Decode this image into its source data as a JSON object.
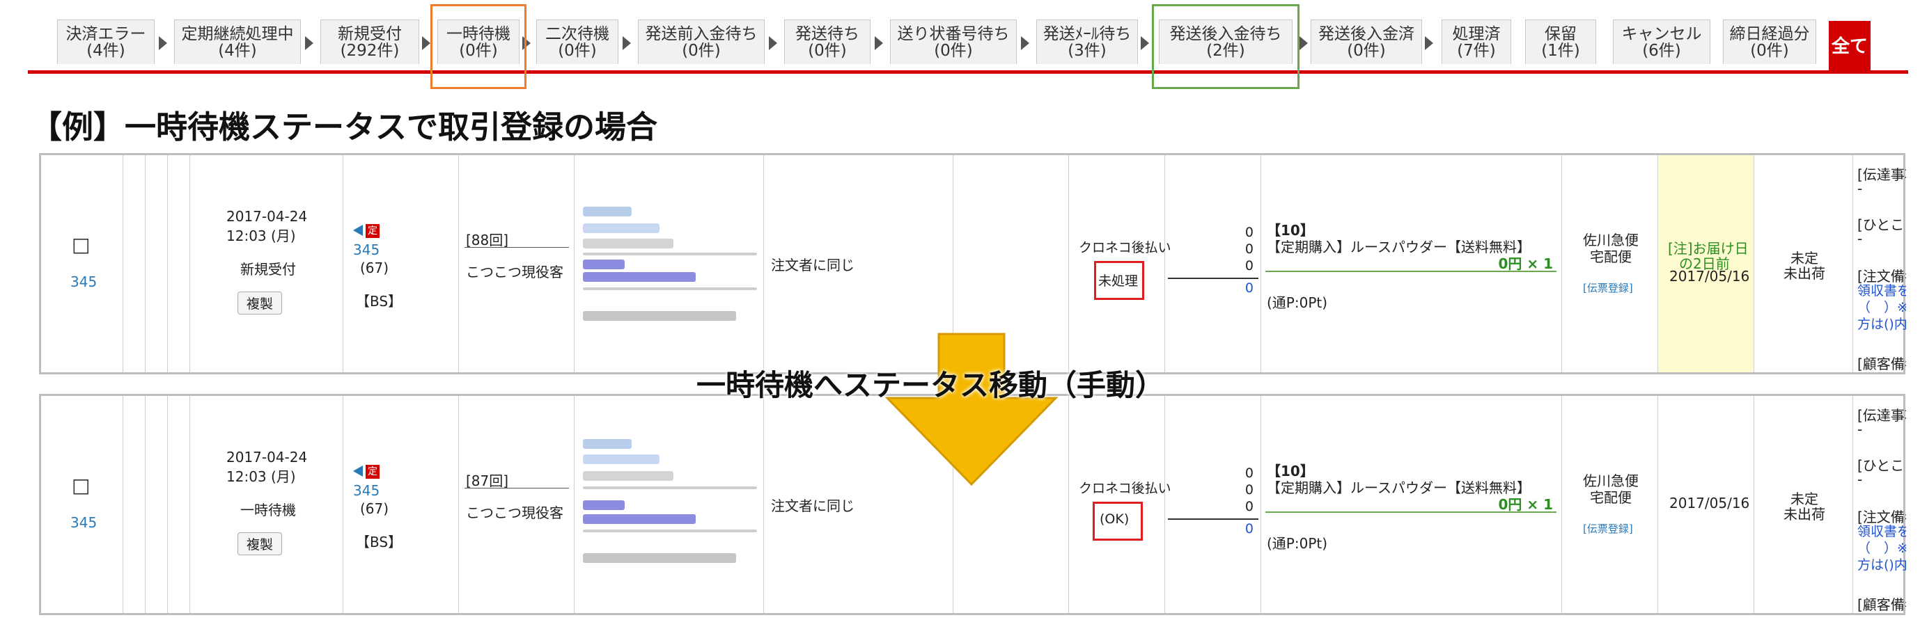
{
  "tabs": [
    {
      "name": "決済エラー",
      "count": "(4件)"
    },
    {
      "name": "定期継続処理中",
      "count": "(4件)"
    },
    {
      "name": "新規受付",
      "count": "(292件)"
    },
    {
      "name": "一時待機",
      "count": "(0件)"
    },
    {
      "name": "二次待機",
      "count": "(0件)"
    },
    {
      "name": "発送前入金待ち",
      "count": "(0件)"
    },
    {
      "name": "発送待ち",
      "count": "(0件)"
    },
    {
      "name": "送り状番号待ち",
      "count": "(0件)"
    },
    {
      "name": "発送ﾒｰﾙ待ち",
      "count": "(3件)"
    },
    {
      "name": "発送後入金待ち",
      "count": "(2件)"
    },
    {
      "name": "発送後入金済",
      "count": "(0件)"
    },
    {
      "name": "処理済",
      "count": "(7件)"
    },
    {
      "name": "保留",
      "count": "(1件)"
    },
    {
      "name": "キャンセル",
      "count": "(6件)"
    },
    {
      "name": "締日経過分",
      "count": "(0件)"
    }
  ],
  "all_tab": "全て",
  "heading": "【例】一時待機ステータスで取引登録の場合",
  "move_label": "一時待機へステータス移動（手動）",
  "orders": [
    {
      "checkbox": "□",
      "id": "345",
      "date": "2017-04-24",
      "time": "12:03 (月)",
      "status": "新規受付",
      "copy_button": "複製",
      "flag": "定",
      "customer_id": "345",
      "customer_count": "(67)",
      "bs": "【BS】",
      "times": "[88回]",
      "rank": "こつこつ現役客",
      "ship_to": "注文者に同じ",
      "payment": "クロネコ後払い",
      "payment_status": "未処理",
      "amounts": [
        "0",
        "0",
        "0",
        "0"
      ],
      "item_no": "【10】",
      "item_name": "【定期購入】ルースパウダー【送料無料】",
      "item_price": "0円 × 1",
      "points": "(通P:0Pt)",
      "carrier": "佐川急便",
      "carrier_type": "宅配便",
      "slip": "[伝票登録]",
      "delivery_note": "[注]お届け日",
      "delivery_note2": "の2日前",
      "delivery_date": "2017/05/16",
      "ship_status1": "未定",
      "ship_status2": "未出荷",
      "memo_label1": "[伝達事項]",
      "memo_value1": "-",
      "memo_label2": "[ひとことメモ]",
      "memo_value2": "-",
      "memo_label3": "[注文備考]",
      "memo_link1": "領収書を希望",
      "memo_link2": "（　）※希",
      "memo_link3": "方は()内に○を",
      "memo_label4": "[顧客備考]"
    },
    {
      "checkbox": "□",
      "id": "345",
      "date": "2017-04-24",
      "time": "12:03 (月)",
      "status": "一時待機",
      "copy_button": "複製",
      "flag": "定",
      "customer_id": "345",
      "customer_count": "(67)",
      "bs": "【BS】",
      "times": "[87回]",
      "rank": "こつこつ現役客",
      "ship_to": "注文者に同じ",
      "payment": "クロネコ後払い",
      "payment_status": "(OK)",
      "amounts": [
        "0",
        "0",
        "0",
        "0"
      ],
      "item_no": "【10】",
      "item_name": "【定期購入】ルースパウダー【送料無料】",
      "item_price": "0円 × 1",
      "points": "(通P:0Pt)",
      "carrier": "佐川急便",
      "carrier_type": "宅配便",
      "slip": "[伝票登録]",
      "delivery_date": "2017/05/16",
      "ship_status1": "未定",
      "ship_status2": "未出荷",
      "memo_label1": "[伝達事項]",
      "memo_value1": "-",
      "memo_label2": "[ひとことメモ]",
      "memo_value2": "-",
      "memo_label3": "[注文備考]",
      "memo_link1": "領収書を希望",
      "memo_link2": "（　）※希",
      "memo_link3": "方は()内に○を",
      "memo_label4": "[顧客備考]"
    }
  ],
  "colors": {
    "accent_red": "#d20000",
    "highlight_orange": "#ef7d2e",
    "highlight_green": "#6aa84f",
    "arrow_fill": "#f5b800",
    "link_blue": "#2a7ab8"
  }
}
